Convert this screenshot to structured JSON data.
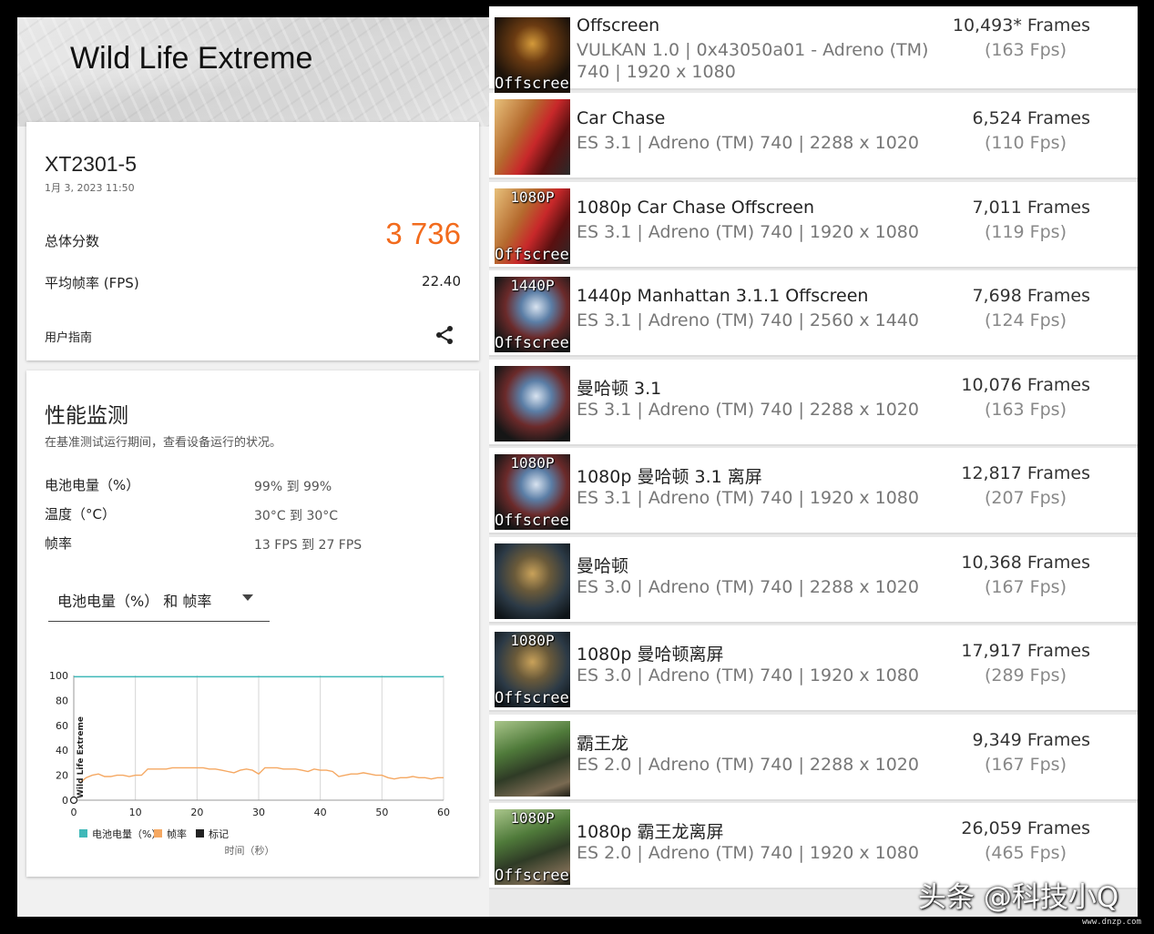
{
  "hero": {
    "title": "Wild Life Extreme"
  },
  "score_card": {
    "device": "XT2301-5",
    "date": "1月 3, 2023 11:50",
    "score_label": "总体分数",
    "score_value": "3 736",
    "fps_label": "平均帧率 (FPS)",
    "fps_value": "22.40",
    "guide_label": "用户指南",
    "share_icon": "share-icon"
  },
  "monitor": {
    "title": "性能监测",
    "description": "在基准测试运行期间，查看设备运行的状况。",
    "stats": [
      {
        "label": "电池电量（%）",
        "value": "99% 到 99%"
      },
      {
        "label": "温度（°C）",
        "value": "30°C 到 30°C"
      },
      {
        "label": "帧率",
        "value": "13 FPS 到 27 FPS"
      }
    ],
    "dropdown_value": "电池电量（%） 和 帧率"
  },
  "chart_data": {
    "type": "line",
    "x": [
      0,
      1,
      2,
      3,
      4,
      5,
      6,
      7,
      8,
      9,
      10,
      11,
      12,
      13,
      14,
      15,
      16,
      17,
      18,
      19,
      20,
      21,
      22,
      23,
      24,
      25,
      26,
      27,
      28,
      29,
      30,
      31,
      32,
      33,
      34,
      35,
      36,
      37,
      38,
      39,
      40,
      41,
      42,
      43,
      44,
      45,
      46,
      47,
      48,
      49,
      50,
      51,
      52,
      53,
      54,
      55,
      56,
      57,
      58,
      59,
      60
    ],
    "series": [
      {
        "name": "电池电量（%）",
        "color": "#3fb8b8",
        "values": [
          99,
          99,
          99,
          99,
          99,
          99,
          99,
          99,
          99,
          99,
          99,
          99,
          99,
          99,
          99,
          99,
          99,
          99,
          99,
          99,
          99,
          99,
          99,
          99,
          99,
          99,
          99,
          99,
          99,
          99,
          99,
          99,
          99,
          99,
          99,
          99,
          99,
          99,
          99,
          99,
          99,
          99,
          99,
          99,
          99,
          99,
          99,
          99,
          99,
          99,
          99,
          99,
          99,
          99,
          99,
          99,
          99,
          99,
          99,
          99,
          99
        ]
      },
      {
        "name": "帧率",
        "color": "#f5a862",
        "values": [
          null,
          14,
          18,
          20,
          21,
          19,
          19,
          20,
          20,
          19,
          20,
          20,
          25,
          25,
          25,
          25,
          26,
          26,
          26,
          26,
          26,
          26,
          25,
          25,
          24,
          23,
          22,
          24,
          25,
          24,
          21,
          26,
          26,
          26,
          25,
          25,
          25,
          24,
          23,
          25,
          24,
          24,
          23,
          19,
          20,
          21,
          21,
          22,
          21,
          20,
          20,
          18,
          17,
          18,
          18,
          19,
          18,
          18,
          17,
          18,
          18
        ]
      }
    ],
    "legend": [
      {
        "name": "电池电量（%）",
        "color": "#3fb8b8"
      },
      {
        "name": "帧率",
        "color": "#f5a862"
      },
      {
        "name": "标记",
        "color": "#222222"
      }
    ],
    "marker_label": "Wild Life Extreme",
    "xlabel": "时间（秒）",
    "ylabel": "",
    "xlim": [
      0,
      60
    ],
    "ylim": [
      0,
      100
    ],
    "xticks": [
      0,
      10,
      20,
      30,
      40,
      50,
      60
    ],
    "yticks": [
      0,
      20,
      40,
      60,
      80,
      100
    ],
    "grid": "vertical",
    "legend_position": "bottom"
  },
  "tests": [
    {
      "name": "Offscreen",
      "detail_line1": "VULKAN 1.0 | 0x43050a01 - Adreno (TM)",
      "detail_line2": "740 | 1920 x 1080",
      "frames": "10,493* Frames",
      "fps": "(163 Fps)",
      "thumb_top": "",
      "thumb_bottom": "Offscreen",
      "scene": "temple"
    },
    {
      "name": "Car Chase",
      "detail": "ES 3.1 | Adreno (TM) 740 | 2288 x 1020",
      "frames": "6,524 Frames",
      "fps": "(110 Fps)",
      "thumb_top": "",
      "thumb_bottom": "",
      "scene": "car"
    },
    {
      "name": "1080p Car Chase Offscreen",
      "detail": "ES 3.1 | Adreno (TM) 740 | 1920 x 1080",
      "frames": "7,011 Frames",
      "fps": "(119 Fps)",
      "thumb_top": "1080P",
      "thumb_bottom": "Offscreen",
      "scene": "car"
    },
    {
      "name": "1440p Manhattan 3.1.1 Offscreen",
      "detail": "ES 3.1 | Adreno (TM) 740 | 2560 x 1440",
      "frames": "7,698 Frames",
      "fps": "(124 Fps)",
      "thumb_top": "1440P",
      "thumb_bottom": "Offscreen",
      "scene": "robot"
    },
    {
      "name": "曼哈顿 3.1",
      "detail": "ES 3.1 | Adreno (TM) 740 | 2288 x 1020",
      "frames": "10,076 Frames",
      "fps": "(163 Fps)",
      "thumb_top": "",
      "thumb_bottom": "",
      "scene": "robot"
    },
    {
      "name": "1080p 曼哈顿 3.1 离屏",
      "detail": "ES 3.1 | Adreno (TM) 740 | 1920 x 1080",
      "frames": "12,817 Frames",
      "fps": "(207 Fps)",
      "thumb_top": "1080P",
      "thumb_bottom": "Offscreen",
      "scene": "robot"
    },
    {
      "name": "曼哈顿",
      "detail": "ES 3.0 | Adreno (TM) 740 | 2288 x 1020",
      "frames": "10,368 Frames",
      "fps": "(167 Fps)",
      "thumb_top": "",
      "thumb_bottom": "",
      "scene": "robot2"
    },
    {
      "name": "1080p 曼哈顿离屏",
      "detail": "ES 3.0 | Adreno (TM) 740 | 1920 x 1080",
      "frames": "17,917 Frames",
      "fps": "(289 Fps)",
      "thumb_top": "1080P",
      "thumb_bottom": "Offscreen",
      "scene": "robot2"
    },
    {
      "name": "霸王龙",
      "detail": "ES 2.0 | Adreno (TM) 740 | 2288 x 1020",
      "frames": "9,349 Frames",
      "fps": "(167 Fps)",
      "thumb_top": "",
      "thumb_bottom": "",
      "scene": "trex"
    },
    {
      "name": "1080p 霸王龙离屏",
      "detail": "ES 2.0 | Adreno (TM) 740 | 1920 x 1080",
      "frames": "26,059 Frames",
      "fps": "(465 Fps)",
      "thumb_top": "1080P",
      "thumb_bottom": "Offscreen",
      "scene": "trex"
    }
  ],
  "watermark": {
    "text": "头条 @科技小Q",
    "site": "www.dnzp.com"
  }
}
